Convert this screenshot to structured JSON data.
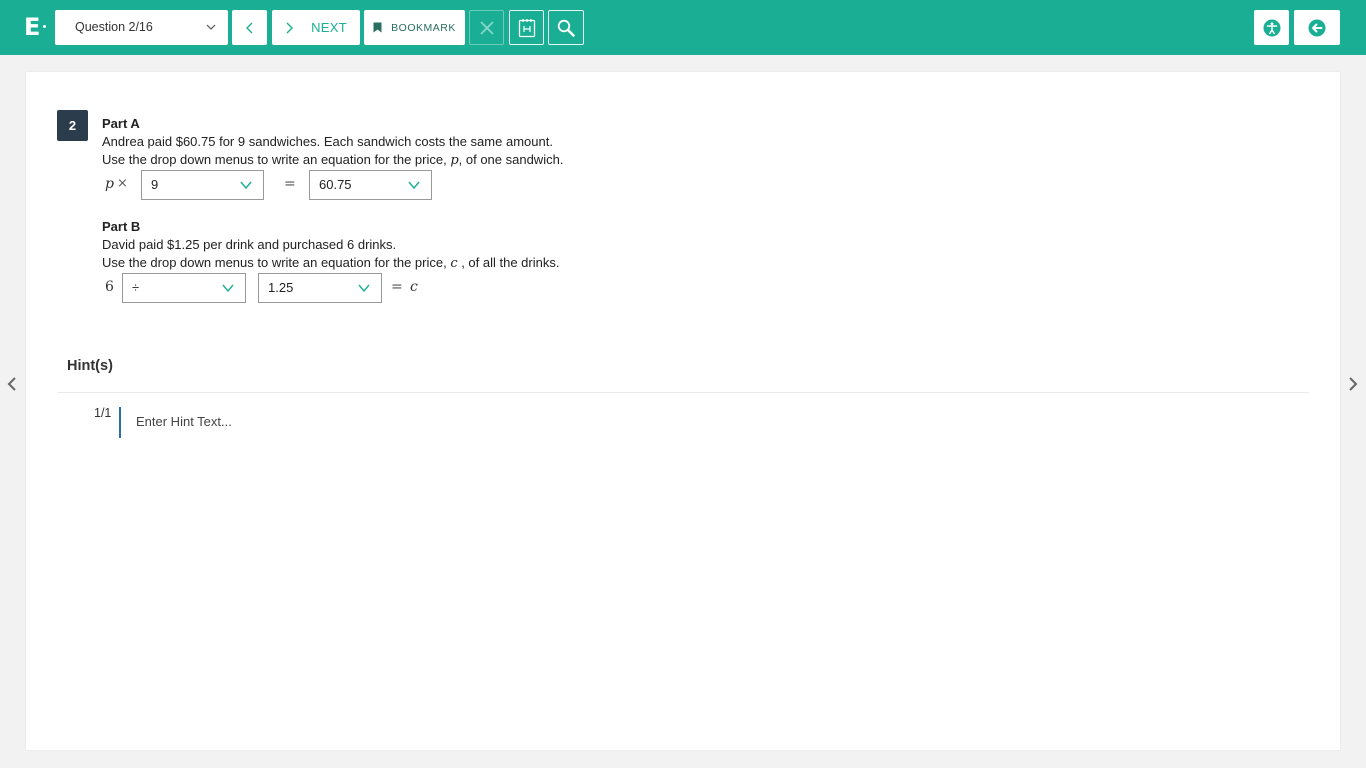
{
  "app": {
    "logo": "E"
  },
  "toolbar": {
    "question_select": "Question 2/16",
    "next_label": "NEXT",
    "bookmark_label": "BOOKMARK"
  },
  "question": {
    "number": "2",
    "part_a": {
      "title": "Part A",
      "line1": "Andrea paid $60.75 for 9 sandwiches.  Each sandwich costs the same amount.",
      "line2_before": "Use the drop down menus to write an equation for the price, ",
      "line2_var": "p",
      "line2_after": ", of one sandwich.",
      "eq_var": "p",
      "eq_op": "×",
      "dropdown1": "9",
      "eq_equals": "=",
      "dropdown2": "60.75"
    },
    "part_b": {
      "title": "Part B",
      "line1": "David paid $1.25 per drink and purchased 6 drinks.",
      "line2_before": "Use the drop down menus to write an equation for the price, ",
      "line2_var": "c",
      "line2_after": " , of all the drinks.",
      "eq_number": "6",
      "dropdown1": "÷",
      "dropdown2": "1.25",
      "eq_equals": "=",
      "eq_var": "c"
    }
  },
  "hints": {
    "title": "Hint(s)",
    "counter": "1/1",
    "placeholder": "Enter Hint Text..."
  },
  "colors": {
    "accent": "#1aaf95",
    "badge": "#2b3c4d",
    "hint_bar": "#2a6ea8"
  },
  "icons": [
    "chevron-left-icon",
    "chevron-right-icon",
    "bookmark-icon",
    "close-icon",
    "calculator-icon",
    "search-icon",
    "accessibility-icon",
    "back-arrow-icon"
  ]
}
